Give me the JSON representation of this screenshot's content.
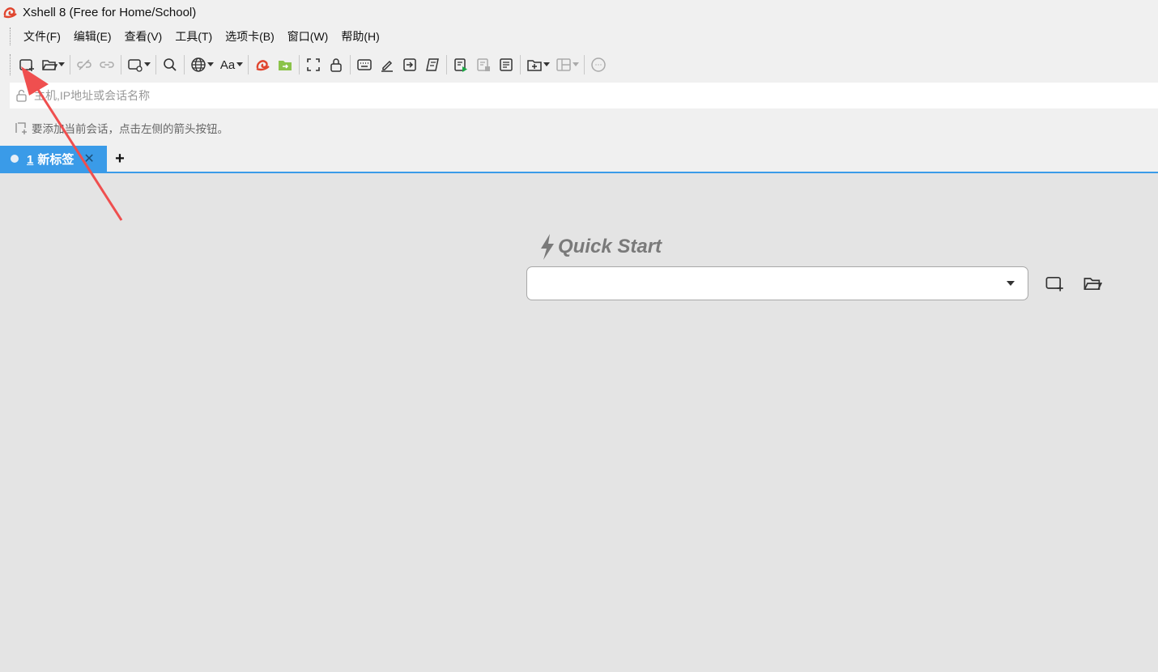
{
  "window": {
    "title": "Xshell 8 (Free for Home/School)"
  },
  "menu": {
    "items": [
      "文件(F)",
      "编辑(E)",
      "查看(V)",
      "工具(T)",
      "选项卡(B)",
      "窗口(W)",
      "帮助(H)"
    ]
  },
  "toolbar": {
    "font_label": "Aa",
    "icons": [
      "new-session-icon",
      "open-folder-icon",
      "disconnect-icon",
      "reconnect-icon",
      "session-properties-icon",
      "search-icon",
      "globe-icon",
      "font-icon",
      "xmanager-icon",
      "xftp-icon",
      "fullscreen-icon",
      "lock-icon",
      "keyboard-icon",
      "highlight-icon",
      "send-icon",
      "script-icon",
      "start-log-icon",
      "stop-log-icon",
      "transfer-icon",
      "add-tab-icon",
      "layout-icon",
      "chat-icon"
    ]
  },
  "address_bar": {
    "placeholder": "主机,IP地址或会话名称",
    "value": ""
  },
  "hint_bar": {
    "text": "要添加当前会话，点击左侧的箭头按钮。"
  },
  "tabs": [
    {
      "number": "1",
      "label": "新标签",
      "active": true
    }
  ],
  "tab_add_label": "+",
  "quick_start": {
    "title": "Quick Start",
    "combo_value": ""
  },
  "colors": {
    "accent": "#3a9be8",
    "annotation_arrow": "#ef4f4f",
    "content_bg": "#e4e4e4"
  }
}
